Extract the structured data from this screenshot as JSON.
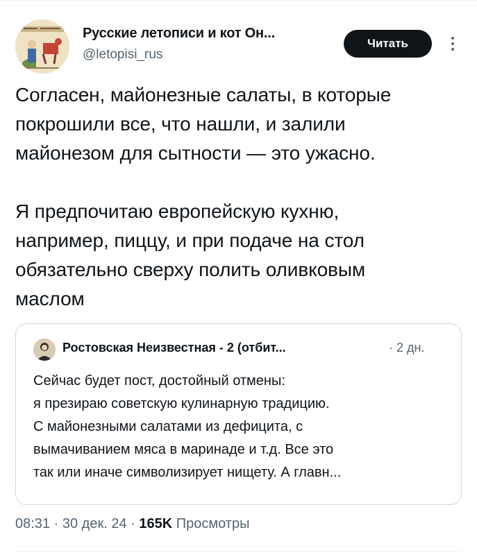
{
  "author": {
    "name": "Русские летописи и кот Он...",
    "handle": "@letopisi_rus"
  },
  "actions": {
    "read_label": "Читать"
  },
  "post": {
    "lines_paragraph_1": [
      "Согласен, майонезные салаты, в которые",
      "покрошили все, что нашли, и залили",
      "майонезом для сытности — это ужасно."
    ],
    "lines_paragraph_2": [
      "Я предпочитаю европейскую кухню,",
      "например, пиццу, и при подаче на стол",
      "обязательно сверху полить оливковым",
      "маслом"
    ]
  },
  "quote": {
    "author_name": "Ростовская Неизвестная - 2 (отбит...",
    "time": "· 2 дн.",
    "lines": [
      "Сейчас будет пост, достойный отмены:",
      "я презираю советскую кулинарную традицию.",
      "С майонезными салатами из дефицита, с",
      "вымачиванием мяса в маринаде и т.д. Все это",
      "так или иначе символизирует нищету. А главн..."
    ]
  },
  "meta": {
    "time": "08:31",
    "separator": "·",
    "date": "30 дек. 24",
    "views_count": "165K",
    "views_label": "Просмотры"
  },
  "icons": {
    "more": "more-vertical-icon"
  },
  "colors": {
    "text_primary": "#0f1419",
    "text_secondary": "#536471",
    "button_bg": "#0f1419",
    "border": "#cfd9de"
  }
}
